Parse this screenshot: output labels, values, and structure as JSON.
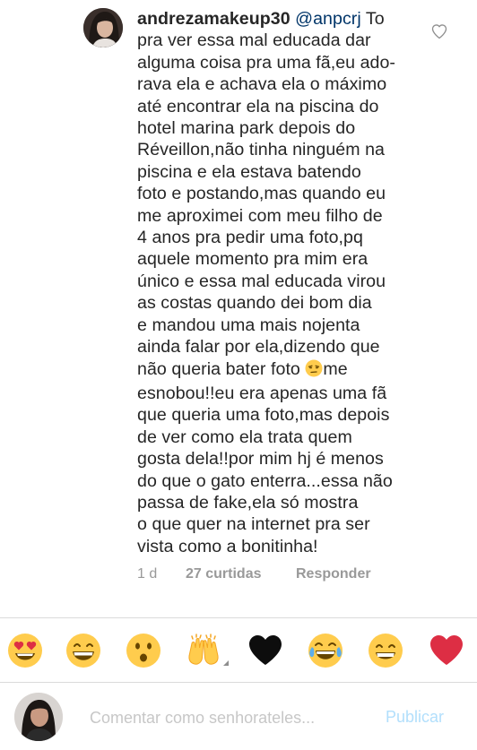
{
  "comment": {
    "username": "andrezamakeup30",
    "mention": "@anpcrj",
    "first_line_rest": " To",
    "lines": [
      "pra ver essa mal educada dar",
      "alguma coisa pra uma fã,eu ado-",
      "rava ela e achava ela o máximo",
      "até encontrar ela na piscina do",
      "hotel marina park depois do",
      "Réveillon,não tinha ninguém na",
      "piscina e ela estava batendo",
      "foto e postando,mas quando eu",
      "me aproximei com meu filho de",
      "4 anos pra pedir uma foto,pq",
      "aquele momento pra mim era",
      "único e essa mal educada virou",
      "as costas quando dei bom dia",
      "e mandou uma mais nojenta",
      "ainda falar por ela,dizendo que"
    ],
    "emoji_line_before": "não queria bater foto ",
    "emoji_line_after": "me",
    "lines_after": [
      "esnobou!!eu era apenas uma fã",
      "que queria uma foto,mas depois",
      "de ver como ela trata quem",
      "gosta dela!!por mim hj é menos",
      "do que o gato enterra...essa não",
      "passa de fake,ela só mostra",
      "o que quer na internet pra ser",
      "vista como a bonitinha!"
    ],
    "inline_emoji": "unamused-face-icon",
    "time": "1 d",
    "likes": "27 curtidas",
    "reply": "Responder"
  },
  "reactions": [
    {
      "name": "heart-eyes-face-icon"
    },
    {
      "name": "grinning-face-icon"
    },
    {
      "name": "surprised-face-icon"
    },
    {
      "name": "raising-hands-icon"
    },
    {
      "name": "black-heart-icon"
    },
    {
      "name": "tears-of-joy-face-icon"
    },
    {
      "name": "grimacing-face-icon"
    },
    {
      "name": "red-heart-icon"
    }
  ],
  "compose": {
    "placeholder": "Comentar como senhorateles...",
    "publish_label": "Publicar"
  },
  "colors": {
    "text": "#262626",
    "mention": "#003569",
    "meta": "#999999",
    "publish": "#b2dffc",
    "divider": "#dbdbdb",
    "emoji_yellow": "#ffcc4d"
  }
}
